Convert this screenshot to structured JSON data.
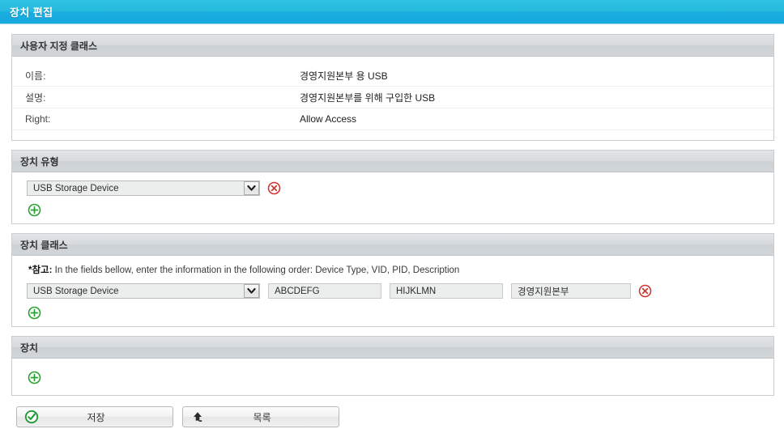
{
  "window": {
    "title": "장치 편집",
    "accent_color": "#1fb3dd"
  },
  "custom_class_panel": {
    "header": "사용자 지정 클래스",
    "rows": [
      {
        "label": "이름:",
        "value": "경영지원본부 용 USB"
      },
      {
        "label": "설명:",
        "value": "경영지원본부를 위해 구입한 USB"
      },
      {
        "label": "Right:",
        "value": "Allow Access"
      }
    ]
  },
  "device_type_panel": {
    "header": "장치 유형",
    "rows": [
      {
        "select_value": "USB Storage Device"
      }
    ],
    "icons": {
      "dropdown": "chevron-down-icon",
      "remove": "remove-circle-icon",
      "add": "add-circle-icon"
    }
  },
  "device_class_panel": {
    "header": "장치 클래스",
    "note_prefix": "*참고:",
    "note_text": " In the fields bellow, enter the information in the following order: Device Type, VID, PID, Description",
    "rows": [
      {
        "select_value": "USB Storage Device",
        "vid": "ABCDEFG",
        "pid": "HIJKLMN",
        "description": "경영지원본부"
      }
    ]
  },
  "device_panel": {
    "header": "장치"
  },
  "footer": {
    "save_label": "저장",
    "list_label": "목록",
    "save_icon": "check-circle-icon",
    "list_icon": "arrow-up-icon"
  }
}
